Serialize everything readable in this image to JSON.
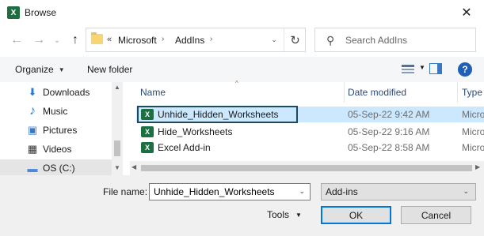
{
  "window": {
    "title": "Browse",
    "app_icon_text": "X",
    "close_glyph": "✕"
  },
  "nav": {
    "back_glyph": "←",
    "forward_glyph": "→",
    "recent_glyph": "⌄",
    "up_glyph": "↑"
  },
  "address": {
    "overflow": "«",
    "breadcrumbs": [
      "Microsoft",
      "AddIns"
    ],
    "separator": "›",
    "dropdown_glyph": "⌄",
    "refresh_glyph": "↻"
  },
  "search": {
    "placeholder": "Search AddIns",
    "icon_glyph": "⚲"
  },
  "toolbar": {
    "organize_label": "Organize",
    "new_folder_label": "New folder",
    "caret": "▼",
    "help_glyph": "?"
  },
  "sidebar": {
    "items": [
      {
        "label": "Downloads",
        "icon": "download-icon",
        "glyph": "⬇",
        "color": "#2e7ad6"
      },
      {
        "label": "Music",
        "icon": "music-icon",
        "glyph": "♪",
        "color": "#2e7ad6"
      },
      {
        "label": "Pictures",
        "icon": "pictures-icon",
        "glyph": "▣",
        "color": "#3a78c2"
      },
      {
        "label": "Videos",
        "icon": "videos-icon",
        "glyph": "▦",
        "color": "#333333"
      },
      {
        "label": "OS (C:)",
        "icon": "drive-icon",
        "glyph": "▬",
        "color": "#4a8ad8"
      }
    ],
    "scroll_up": "▲",
    "scroll_down": "▼"
  },
  "file_list": {
    "sort_caret": "^",
    "columns": [
      "Name",
      "Date modified",
      "Type"
    ],
    "rows": [
      {
        "name": "Unhide_Hidden_Worksheets",
        "date": "05-Sep-22 9:42 AM",
        "type": "Micro",
        "selected": true
      },
      {
        "name": "Hide_Worksheets",
        "date": "05-Sep-22 9:16 AM",
        "type": "Micro",
        "selected": false
      },
      {
        "name": "Excel Add-in",
        "date": "05-Sep-22 8:58 AM",
        "type": "Micro",
        "selected": false
      }
    ],
    "file_icon_text": "X",
    "hscroll_left": "◀",
    "hscroll_right": "▶"
  },
  "footer": {
    "file_name_label": "File name:",
    "file_name_value": "Unhide_Hidden_Worksheets",
    "file_type_value": "Add-ins",
    "dropdown_glyph": "⌄",
    "tools_label": "Tools",
    "ok_label": "OK",
    "cancel_label": "Cancel"
  },
  "colors": {
    "selection": "#cce8ff",
    "focus_border": "#1e4b5a",
    "excel_green": "#1d6f42",
    "accent": "#0078d7"
  }
}
